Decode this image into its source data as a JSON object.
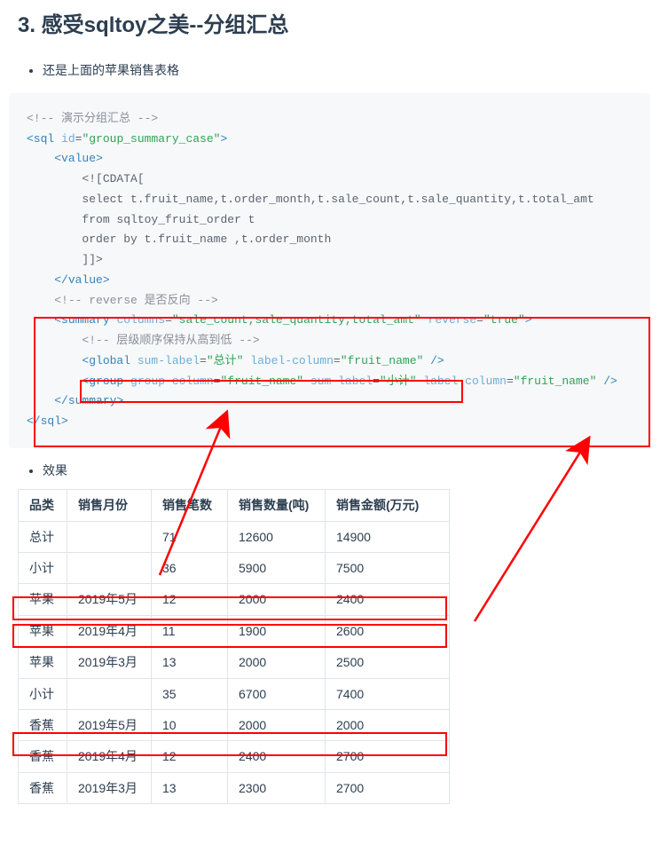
{
  "heading": "3. 感受sqltoy之美--分组汇总",
  "bullet1": "还是上面的苹果销售表格",
  "bullet2": "效果",
  "code": {
    "c1": "<!-- 演示分组汇总 -->",
    "l2_open": "<sql",
    "l2_a1": " id",
    "l2_eq": "=",
    "l2_v1": "\"group_summary_case\"",
    "l2_close": ">",
    "l3": "<value>",
    "l4": "<![CDATA[",
    "l5": "select t.fruit_name,t.order_month,t.sale_count,t.sale_quantity,t.total_amt",
    "l6": "from sqltoy_fruit_order t",
    "l7": "order by t.fruit_name ,t.order_month",
    "l8": "]]>",
    "l9": "</value>",
    "c2": "<!-- reverse 是否反向 -->",
    "l10_open": "<summary",
    "l10_a1": " columns",
    "l10_v1": "\"sale_count,sale_quantity,total_amt\"",
    "l10_a2": " reverse",
    "l10_v2": "\"true\"",
    "l10_close": ">",
    "c3": "<!-- 层级顺序保持从高到低 -->",
    "l11_open": "<global",
    "l11_a1": " sum-label",
    "l11_v1": "\"总计\"",
    "l11_a2": " label-column",
    "l11_v2": "\"fruit_name\"",
    "l11_close": " />",
    "l12_open": "<group",
    "l12_a1": " group-column",
    "l12_v1": "\"fruit_name\"",
    "l12_a2": " sum-label",
    "l12_v2": "\"小计\"",
    "l12_a3": " label-column",
    "l12_v3": "\"fruit_name\"",
    "l12_close": " />",
    "l13": "</summary>",
    "l14": "</sql>"
  },
  "table": {
    "headers": [
      "品类",
      "销售月份",
      "销售笔数",
      "销售数量(吨)",
      "销售金额(万元)"
    ],
    "rows": [
      [
        "总计",
        "",
        "71",
        "12600",
        "14900"
      ],
      [
        "小计",
        "",
        "36",
        "5900",
        "7500"
      ],
      [
        "苹果",
        "2019年5月",
        "12",
        "2000",
        "2400"
      ],
      [
        "苹果",
        "2019年4月",
        "11",
        "1900",
        "2600"
      ],
      [
        "苹果",
        "2019年3月",
        "13",
        "2000",
        "2500"
      ],
      [
        "小计",
        "",
        "35",
        "6700",
        "7400"
      ],
      [
        "香蕉",
        "2019年5月",
        "10",
        "2000",
        "2000"
      ],
      [
        "香蕉",
        "2019年4月",
        "12",
        "2400",
        "2700"
      ],
      [
        "香蕉",
        "2019年3月",
        "13",
        "2300",
        "2700"
      ]
    ]
  }
}
